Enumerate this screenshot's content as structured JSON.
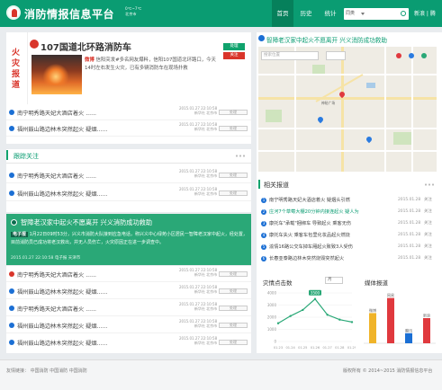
{
  "header": {
    "title": "消防情报信息平台",
    "weather_line1": "0℃~7℃",
    "weather_line2": "北京市",
    "nav": [
      "首页",
      "历史",
      "统计"
    ],
    "search_select": "同类",
    "login": "新浪 | 腾"
  },
  "hot": {
    "tag": "火灾报道",
    "title": "107国道北环路消防车",
    "body_prefix": "微博",
    "body": "信阳突发#多名网友爆料，信阳107国道北环路口，今天14时左右发生火灾，已有多辆消防车在现场扑救",
    "meta": "2015.01.27 22:10:58   网易   北京市",
    "btn_top": "处理",
    "btn_bottom": "关注"
  },
  "top_rows": [
    {
      "title": "南宁明秀路天妃大酒店着火 ......",
      "date": "2015.01.27 22:10:58",
      "src": "新华社 北京市",
      "btn": "处理"
    },
    {
      "title": "福州鼓山路边林木突然起火 疑烟......",
      "date": "2015.01.27 22:10:58",
      "src": "新华社 北京市",
      "btn": "处理"
    }
  ],
  "follow": {
    "heading": "跟踪关注",
    "rows": [
      {
        "title": "南宁明秀路天妃大酒店着火 ......",
        "date": "2015.01.27 22:10:58",
        "src": "新华社 北京市",
        "btn": "处理"
      },
      {
        "title": "福州鼓山路边林木突然起火 疑烟......",
        "date": "2015.01.27 22:10:58",
        "src": "新华社 北京市",
        "btn": "处理"
      }
    ]
  },
  "highlight": {
    "title": "智障老汉家中起火不愿离开 兴义消防成功救助",
    "tag": "电子报",
    "body": "1月22日09时53分，兴义市消防大队接到应急电话，称兴义中心绿苑小区居民一智障老汉家中起火，经处置，目前消防员已成功将老汉救出，并无人员伤亡，火灾原因正在进一步调查中。",
    "meta": "2015.01.27 22:10:58    电子报   天津市"
  },
  "bottom_rows": [
    {
      "title": "南宁明秀路天妃大酒店着火 ......",
      "date": "2015.01.27 22:10:58",
      "src": "新华社 北京市",
      "btn": "处理"
    },
    {
      "title": "福州鼓山路边林木突然起火 疑烟......",
      "date": "2015.01.27 22:10:58",
      "src": "新华社 北京市",
      "btn": "处理"
    },
    {
      "title": "南宁明秀路天妃大酒店着火 ......",
      "date": "2015.01.27 22:10:58",
      "src": "新华社 北京市",
      "btn": "处理"
    },
    {
      "title": "福州鼓山路边林木突然起火 疑烟......",
      "date": "2015.01.27 22:10:58",
      "src": "新华社 北京市",
      "btn": "处理"
    },
    {
      "title": "福州鼓山路边林木突然起火 疑烟......",
      "date": "2015.01.27 22:10:58",
      "src": "新华社 北京市",
      "btn": "处理"
    }
  ],
  "map": {
    "title": "智障老汉家中起火不愿离开 兴义消防成功救助",
    "search_placeholder": "搜索位置",
    "labels": [
      "神秘广场"
    ]
  },
  "related": {
    "heading": "相关报道",
    "items": [
      {
        "n": "1",
        "title": "南宁明秀路天妃大酒店着火 疑烟头引燃",
        "date": "2015.01.28",
        "count": "关注"
      },
      {
        "n": "2",
        "title": "庄河7个草莓大棚20分钟内接连起火 疑人为",
        "date": "2015.01.28",
        "count": "关注"
      },
      {
        "n": "3",
        "title": "康托车\"承载\"捆绑车 导致起火 乘客无伤",
        "date": "2015.01.28",
        "count": "关注"
      },
      {
        "n": "4",
        "title": "康托车失火 乘客车包里化妆品起火燃烧",
        "date": "2015.01.28",
        "count": "关注"
      },
      {
        "n": "5",
        "title": "渝情16路公交车掉车厢起火致致3人受伤",
        "date": "2015.01.28",
        "count": "关注"
      },
      {
        "n": "6",
        "title": "长春亚泰路边林木突然烧毁突然起火",
        "date": "2015.01.28",
        "count": "关注"
      }
    ]
  },
  "chart1": {
    "heading": "灾情点击数",
    "select": "月",
    "marker": "3500",
    "chart_data": {
      "type": "line",
      "x": [
        "01.23",
        "01.24",
        "01.25",
        "01.26",
        "01.27",
        "01.28",
        "01.29"
      ],
      "values": [
        1500,
        2100,
        2600,
        3500,
        2200,
        1800,
        1600
      ],
      "ylim": [
        0,
        4000
      ],
      "yticks": [
        "4000",
        "3000",
        "2000",
        "1000",
        "0"
      ]
    }
  },
  "chart2": {
    "heading": "媒体报道",
    "chart_data": {
      "type": "bar",
      "categories": [
        "微博",
        "网易",
        "腾讯",
        "新浪"
      ],
      "values": [
        6,
        9,
        2,
        5
      ],
      "value_labels": [
        "微博",
        "网易",
        "腾讯",
        "新浪"
      ],
      "colors": [
        "#f0b429",
        "#e0393e",
        "#1b6fd4",
        "#e0393e"
      ],
      "ylim": [
        0,
        10
      ]
    }
  },
  "footer": {
    "left": "友情链接：  中国消防   中国消防   中国消防",
    "right": "版权所有 © 2014~2015  消防情报信息平台"
  }
}
